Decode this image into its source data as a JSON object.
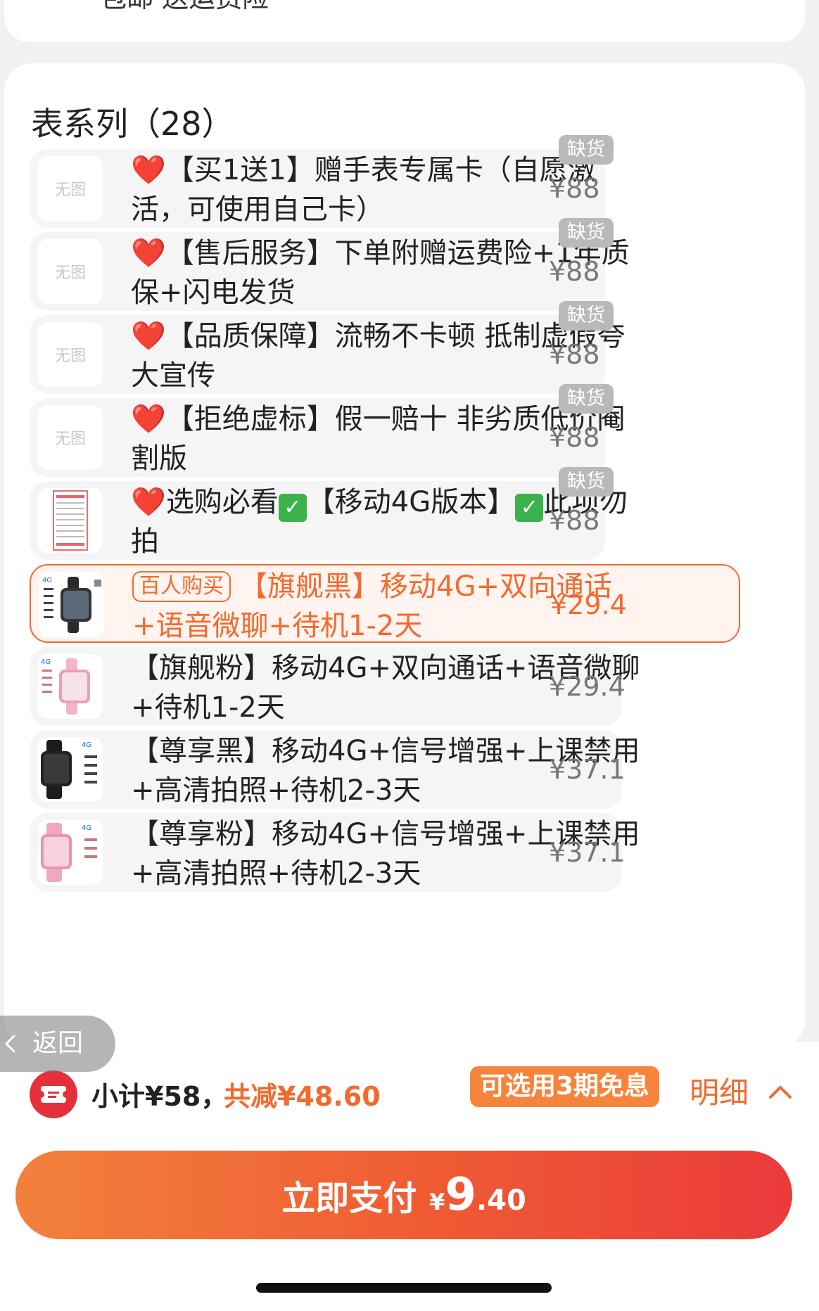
{
  "top_card": {
    "text": "包邮 送运费险"
  },
  "section": {
    "title": "表系列（28）"
  },
  "variants": [
    {
      "prefix": "❤️",
      "name": "【买1送1】赠手表专属卡（自愿激活，可使用自己卡）",
      "price": "¥88",
      "badge": "缺货",
      "thumb_text": "无图"
    },
    {
      "prefix": "❤️",
      "name": "【售后服务】下单附赠运费险+1年质保+闪电发货",
      "price": "¥88",
      "badge": "缺货",
      "thumb_text": "无图"
    },
    {
      "prefix": "❤️",
      "name": "【品质保障】流畅不卡顿 抵制虚假夸大宣传",
      "price": "¥88",
      "badge": "缺货",
      "thumb_text": "无图"
    },
    {
      "prefix": "❤️",
      "name": "【拒绝虚标】假一赔十 非劣质低价阉割版",
      "price": "¥88",
      "badge": "缺货",
      "thumb_text": "无图"
    },
    {
      "prefix": "❤️",
      "name_a": "选购必看",
      "name_b": "【移动4G版本】",
      "name_c": "此项勿拍",
      "check": "✓",
      "price": "¥88",
      "badge": "缺货"
    },
    {
      "tag": "百人购买",
      "name": "【旗舰黑】移动4G+双向通话+语音微聊+待机1-2天",
      "price": "¥29.4"
    },
    {
      "name": "【旗舰粉】移动4G+双向通话+语音微聊+待机1-2天",
      "price": "¥29.4"
    },
    {
      "name": "【尊享黑】移动4G+信号增强+上课禁用+高清拍照+待机2-3天",
      "price": "¥37.1"
    },
    {
      "name": "【尊享粉】移动4G+信号增强+上课禁用+高清拍照+待机2-3天",
      "price": "¥37.1"
    }
  ],
  "back": {
    "label": "返回",
    "icon": "chevron-left-icon"
  },
  "summary": {
    "subtotal": "小计¥58，",
    "discount": "共减¥48.60",
    "installment": "可选用3期免息",
    "detail": "明细",
    "detail_icon": "chevron-up-icon"
  },
  "pay": {
    "label": "立即支付",
    "currency": "¥",
    "amount_int": "9",
    "amount_dec": ".40"
  },
  "colors": {
    "accent": "#f26a2e",
    "heart": "#e5212f",
    "button_start": "#f2813c",
    "button_end": "#ea3a3a"
  }
}
